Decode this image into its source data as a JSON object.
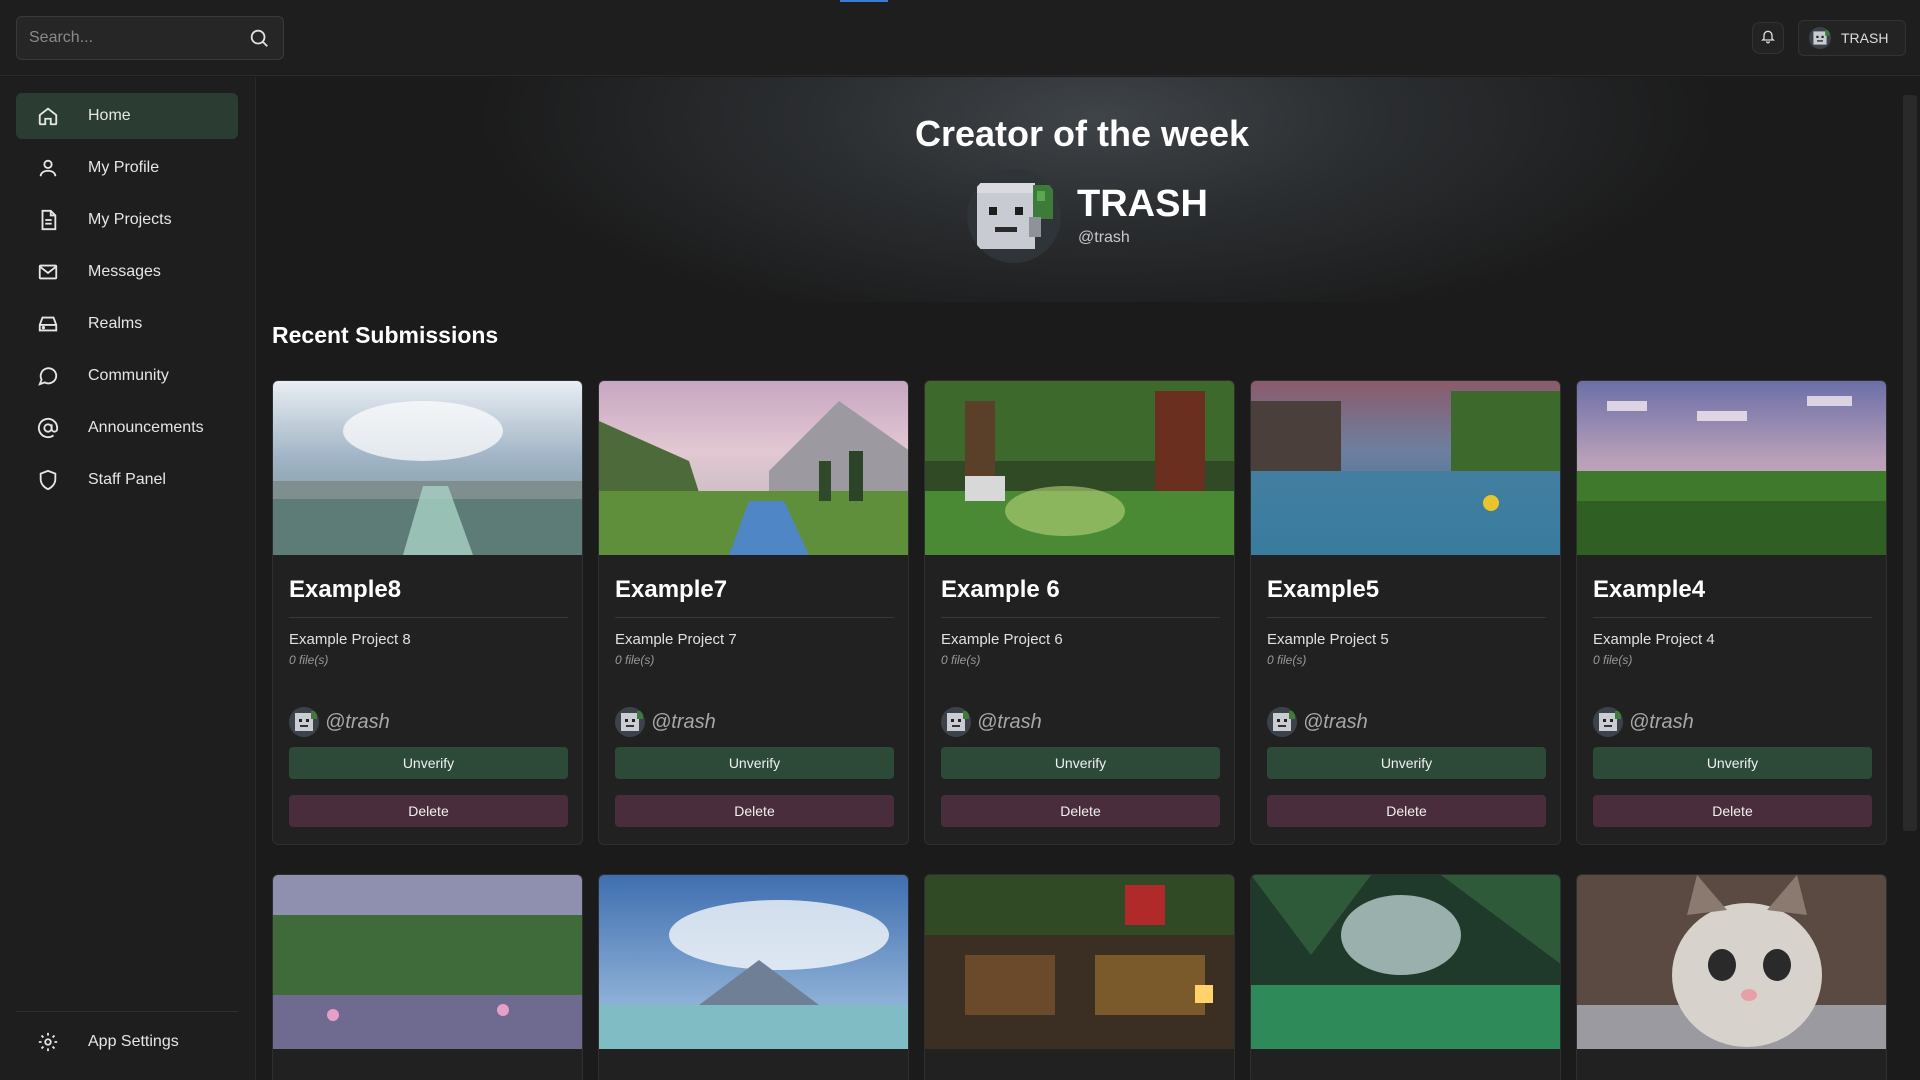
{
  "search": {
    "placeholder": "Search..."
  },
  "user": {
    "name": "TRASH"
  },
  "sidebar": {
    "items": [
      {
        "label": "Home",
        "icon": "home-icon",
        "active": true
      },
      {
        "label": "My Profile",
        "icon": "user-icon"
      },
      {
        "label": "My Projects",
        "icon": "document-icon"
      },
      {
        "label": "Messages",
        "icon": "mail-icon"
      },
      {
        "label": "Realms",
        "icon": "server-icon"
      },
      {
        "label": "Community",
        "icon": "chat-icon"
      },
      {
        "label": "Announcements",
        "icon": "at-icon"
      },
      {
        "label": "Staff Panel",
        "icon": "shield-icon"
      }
    ],
    "settings_label": "App Settings"
  },
  "hero": {
    "title": "Creator of the week",
    "name": "TRASH",
    "handle": "@trash"
  },
  "section": {
    "title": "Recent Submissions"
  },
  "cards": [
    {
      "title": "Example8",
      "description": "Example Project 8",
      "files": "0 file(s)",
      "author": "@trash",
      "unverify": "Unverify",
      "delete": "Delete",
      "scene": "sky-water"
    },
    {
      "title": "Example7",
      "description": "Example Project 7",
      "files": "0 file(s)",
      "author": "@trash",
      "unverify": "Unverify",
      "delete": "Delete",
      "scene": "mountain-river"
    },
    {
      "title": "Example 6",
      "description": "Example Project 6",
      "files": "0 file(s)",
      "author": "@trash",
      "unverify": "Unverify",
      "delete": "Delete",
      "scene": "forest-sun"
    },
    {
      "title": "Example5",
      "description": "Example Project 5",
      "files": "0 file(s)",
      "author": "@trash",
      "unverify": "Unverify",
      "delete": "Delete",
      "scene": "lake-sunset"
    },
    {
      "title": "Example4",
      "description": "Example Project 4",
      "files": "0 file(s)",
      "author": "@trash",
      "unverify": "Unverify",
      "delete": "Delete",
      "scene": "jungle"
    }
  ],
  "cards_row2": [
    {
      "scene": "cherry-forest"
    },
    {
      "scene": "clouds-lake"
    },
    {
      "scene": "village-night"
    },
    {
      "scene": "tree-canopy"
    },
    {
      "scene": "kitten"
    }
  ],
  "colors": {
    "accent_green": "#2d4a38",
    "delete_plum": "#4a2d3c",
    "active_nav": "#2b3d33"
  }
}
